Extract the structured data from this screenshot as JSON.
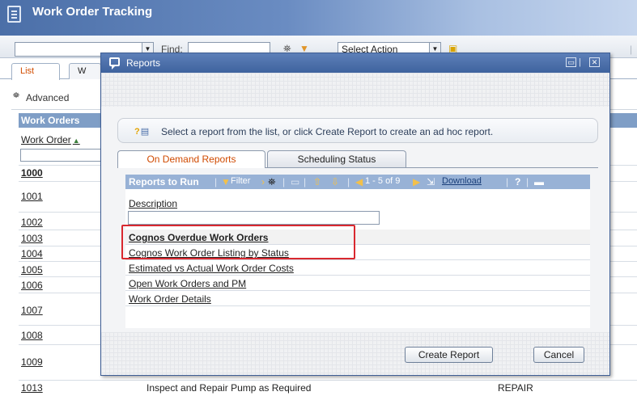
{
  "app": {
    "title": "Work Order Tracking",
    "toolbar": {
      "find_label": "Find:",
      "select_action": "Select Action"
    },
    "tabs": [
      "List",
      "W"
    ],
    "advanced_label": "Advanced",
    "list": {
      "header": "Work Orders",
      "column": "Work Order",
      "rows": [
        {
          "id": "1000",
          "desc": "",
          "type": "",
          "bold": true
        },
        {
          "id": "1001",
          "desc": "",
          "type": ""
        },
        {
          "id": "1002",
          "desc": "",
          "type": ""
        },
        {
          "id": "1003",
          "desc": "",
          "type": ""
        },
        {
          "id": "1004",
          "desc": "",
          "type": ""
        },
        {
          "id": "1005",
          "desc": "",
          "type": ""
        },
        {
          "id": "1006",
          "desc": "",
          "type": ""
        },
        {
          "id": "1007",
          "desc": "",
          "type": ""
        },
        {
          "id": "1008",
          "desc": "",
          "type": ""
        },
        {
          "id": "1009",
          "desc": "",
          "type": ""
        },
        {
          "id": "1013",
          "desc": "Inspect and Repair Pump as Required",
          "type": "REPAIR"
        }
      ]
    }
  },
  "dialog": {
    "title": "Reports",
    "message": "Select a report from the list, or click Create Report to create an ad hoc report.",
    "tabs": {
      "active": "On Demand Reports",
      "inactive": "Scheduling Status"
    },
    "table": {
      "title": "Reports to Run",
      "filter_label": "Filter",
      "pager": "1 - 5 of 9",
      "download_label": "Download",
      "help_label": "?",
      "column": "Description",
      "rows": [
        "Cognos Overdue Work Orders",
        "Cognos Work Order Listing by Status",
        "Estimated vs Actual Work Order Costs",
        "Open Work Orders and PM",
        "Work Order Details"
      ]
    },
    "buttons": {
      "create": "Create Report",
      "cancel": "Cancel"
    }
  },
  "colors": {
    "header_blue": "#4b6fa8",
    "active_tab_orange": "#d04a00",
    "highlight_red": "#d9282f"
  }
}
